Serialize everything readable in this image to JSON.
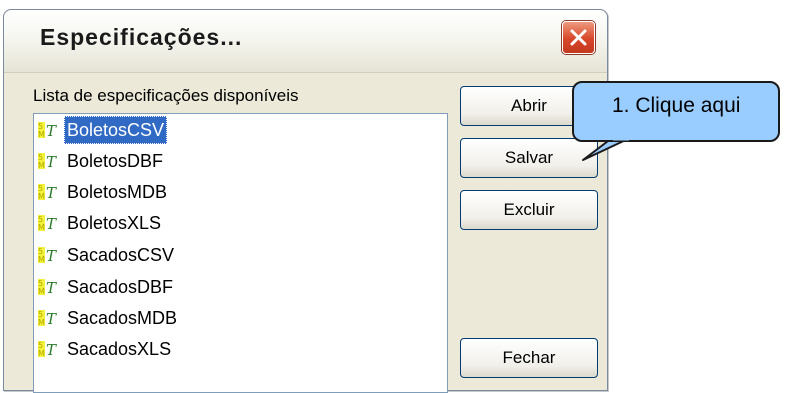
{
  "dialog": {
    "title": "Especificações..."
  },
  "list": {
    "label": "Lista de especificações disponíveis",
    "items": [
      {
        "label": "BoletosCSV",
        "icon": "spec-icon",
        "selected": true
      },
      {
        "label": "BoletosDBF",
        "icon": "spec-icon"
      },
      {
        "label": "BoletosMDB",
        "icon": "spec-icon"
      },
      {
        "label": "BoletosXLS",
        "icon": "spec-icon"
      },
      {
        "label": "SacadosCSV",
        "icon": "spec-icon"
      },
      {
        "label": "SacadosDBF",
        "icon": "spec-icon"
      },
      {
        "label": "SacadosMDB",
        "icon": "spec-icon"
      },
      {
        "label": "SacadosXLS",
        "icon": "spec-icon"
      }
    ]
  },
  "buttons": {
    "open": "Abrir",
    "save": "Salvar",
    "delete": "Excluir",
    "close": "Fechar"
  },
  "callout": {
    "text": "1. Clique aqui"
  },
  "colors": {
    "selection": "#316ac5",
    "callout_fill": "#99ccff",
    "window_bg": "#ece9d8"
  }
}
